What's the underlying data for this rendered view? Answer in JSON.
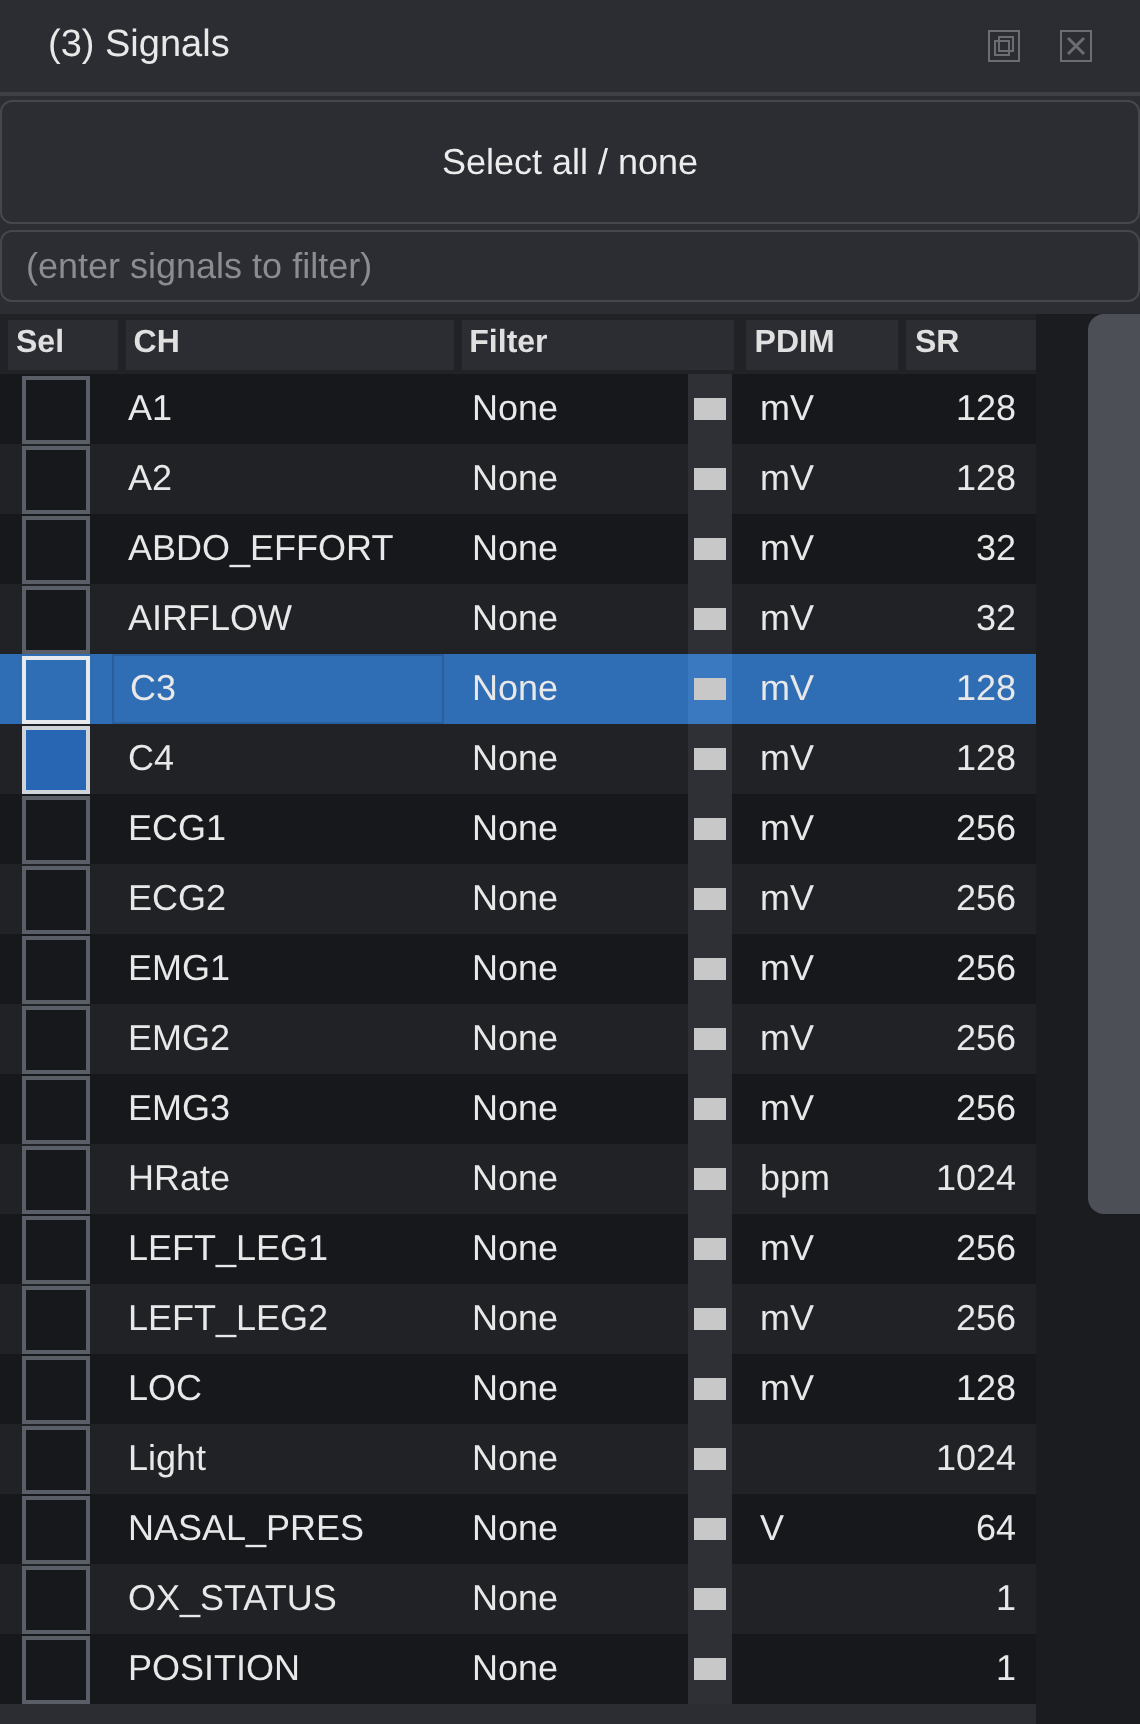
{
  "window": {
    "title": "(3) Signals"
  },
  "select_button": "Select all / none",
  "filter": {
    "placeholder": "(enter signals to filter)"
  },
  "table": {
    "columns": [
      "Sel",
      "CH",
      "Filter",
      "PDIM",
      "SR"
    ],
    "rows": [
      {
        "ch": "A1",
        "filter": "None",
        "pdim": "mV",
        "sr": "128",
        "checked": false,
        "selected": false
      },
      {
        "ch": "A2",
        "filter": "None",
        "pdim": "mV",
        "sr": "128",
        "checked": false,
        "selected": false
      },
      {
        "ch": "ABDO_EFFORT",
        "filter": "None",
        "pdim": "mV",
        "sr": "32",
        "checked": false,
        "selected": false
      },
      {
        "ch": "AIRFLOW",
        "filter": "None",
        "pdim": "mV",
        "sr": "32",
        "checked": false,
        "selected": false
      },
      {
        "ch": "C3",
        "filter": "None",
        "pdim": "mV",
        "sr": "128",
        "checked": false,
        "selected": true
      },
      {
        "ch": "C4",
        "filter": "None",
        "pdim": "mV",
        "sr": "128",
        "checked": true,
        "selected": false
      },
      {
        "ch": "ECG1",
        "filter": "None",
        "pdim": "mV",
        "sr": "256",
        "checked": false,
        "selected": false
      },
      {
        "ch": "ECG2",
        "filter": "None",
        "pdim": "mV",
        "sr": "256",
        "checked": false,
        "selected": false
      },
      {
        "ch": "EMG1",
        "filter": "None",
        "pdim": "mV",
        "sr": "256",
        "checked": false,
        "selected": false
      },
      {
        "ch": "EMG2",
        "filter": "None",
        "pdim": "mV",
        "sr": "256",
        "checked": false,
        "selected": false
      },
      {
        "ch": "EMG3",
        "filter": "None",
        "pdim": "mV",
        "sr": "256",
        "checked": false,
        "selected": false
      },
      {
        "ch": "HRate",
        "filter": "None",
        "pdim": "bpm",
        "sr": "1024",
        "checked": false,
        "selected": false
      },
      {
        "ch": "LEFT_LEG1",
        "filter": "None",
        "pdim": "mV",
        "sr": "256",
        "checked": false,
        "selected": false
      },
      {
        "ch": "LEFT_LEG2",
        "filter": "None",
        "pdim": "mV",
        "sr": "256",
        "checked": false,
        "selected": false
      },
      {
        "ch": "LOC",
        "filter": "None",
        "pdim": "mV",
        "sr": "128",
        "checked": false,
        "selected": false
      },
      {
        "ch": "Light",
        "filter": "None",
        "sr": "1024",
        "checked": false,
        "selected": false
      },
      {
        "ch": "NASAL_PRES",
        "filter": "None",
        "pdim": "V",
        "sr": "64",
        "checked": false,
        "selected": false
      },
      {
        "ch": "OX_STATUS",
        "filter": "None",
        "sr": "1",
        "checked": false,
        "selected": false
      },
      {
        "ch": "POSITION",
        "filter": "None",
        "sr": "1",
        "checked": false,
        "selected": false
      }
    ]
  }
}
